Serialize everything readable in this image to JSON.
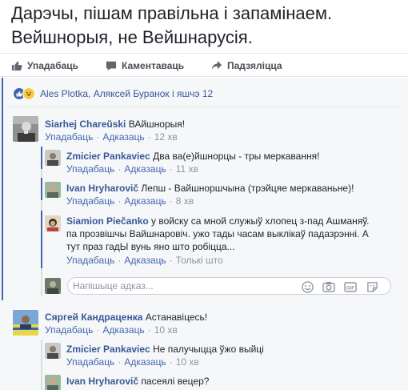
{
  "post": {
    "line1": "Дарэчы, пішам правільна і запамінаем.",
    "line2": "Вейшнорыя, не Вейшнарусія."
  },
  "actions": {
    "like": "Упадабаць",
    "comment": "Каментаваць",
    "share": "Падзяліцца"
  },
  "reactions": {
    "summary": "Ales Plotka, Аляксей Буранок і яшчэ 12"
  },
  "comments": [
    {
      "author": "Siarhej Chareŭski",
      "text": "ВАйшнорыя!",
      "like": "Упадабаць",
      "reply": "Адказаць",
      "time": "12 хв"
    },
    {
      "author": "Zmicier Pankaviec",
      "text": "Два ва(е)йшнорцы - тры меркавання!",
      "like": "Упадабаць",
      "reply": "Адказаць",
      "time": "11 хв"
    },
    {
      "author": "Ivan Hryharovič",
      "text": "Лепш - Вайшноршчына (трэйцяе меркаваньне)!",
      "like": "Упадабаць",
      "reply": "Адказаць",
      "time": "8 хв"
    },
    {
      "author": "Siamion Piečanko",
      "text_line1": "у войску са мной служыў хлопец з-пад Ашманяў.",
      "text_line2": "па прозвішчы Вайшнаровіч. ужо тады часам выклікаў падазрэнні. А",
      "text_line3": "тут праз гадЫ вунь яно што робіцца...",
      "like": "Упадабаць",
      "reply": "Адказаць",
      "time": "Толькі што"
    },
    {
      "author": "Сяргей Кандраценка",
      "text": "Астанавіцесь!",
      "like": "Упадабаць",
      "reply": "Адказаць",
      "time": "10 хв"
    },
    {
      "author": "Zmicier Pankaviec",
      "text": "Не палучыцца ўжо выйці",
      "like": "Упадабаць",
      "reply": "Адказаць",
      "time": "10 хв"
    },
    {
      "author": "Ivan Hryharovič",
      "text": "пасеялі вецер?"
    }
  ],
  "reply_box": {
    "placeholder": "Напішыце адказ..."
  },
  "colors": {
    "link": "#385898",
    "accent": "#4267b2",
    "meta": "#90949c",
    "background": "#f6f7f9"
  }
}
